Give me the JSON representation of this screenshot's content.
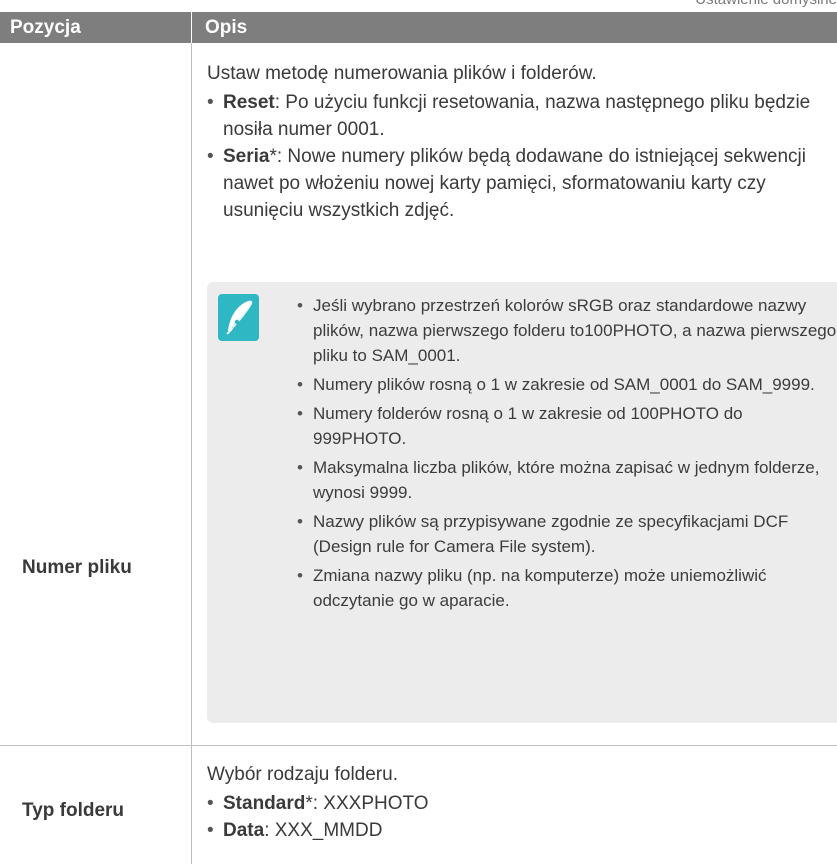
{
  "top_label": "Ustawienie domyślne",
  "header": {
    "col1": "Pozycja",
    "col2": "Opis"
  },
  "row1": {
    "item": "Numer pliku",
    "intro": "Ustaw metodę numerowania plików i folderów.",
    "options": [
      {
        "term": "Reset",
        "text": ": Po użyciu funkcji resetowania, nazwa następnego pliku będzie nosiła numer 0001."
      },
      {
        "term": "Seria",
        "text": "*: Nowe numery plików będą dodawane do istniejącej sekwencji nawet po włożeniu nowej karty pamięci, sformatowaniu karty czy usunięciu wszystkich zdjęć."
      }
    ],
    "note": {
      "icon": "pen-note-icon",
      "items": [
        "Jeśli wybrano przestrzeń kolorów sRGB oraz standardowe nazwy plików, nazwa pierwszego folderu to100PHOTO, a nazwa pierwszego pliku to SAM_0001.",
        "Numery plików rosną o 1 w zakresie od SAM_0001 do SAM_9999.",
        "Numery folderów rosną o 1 w zakresie od 100PHOTO do 999PHOTO.",
        "Maksymalna liczba plików, które można zapisać w jednym folderze, wynosi 9999.",
        "Nazwy plików są przypisywane zgodnie ze specyfikacjami DCF (Design rule for Camera File system).",
        "Zmiana nazwy pliku (np. na komputerze) może uniemożliwić odczytanie go w aparacie."
      ]
    }
  },
  "row2": {
    "item": "Typ folderu",
    "intro": "Wybór rodzaju folderu.",
    "options": [
      {
        "term": "Standard",
        "text": "*: XXXPHOTO"
      },
      {
        "term": "Data",
        "text": ": XXX_MMDD"
      }
    ]
  },
  "colors": {
    "header_bg": "#7e7e7e",
    "note_bg": "#ececec",
    "icon_bg": "#2fb7c3"
  }
}
